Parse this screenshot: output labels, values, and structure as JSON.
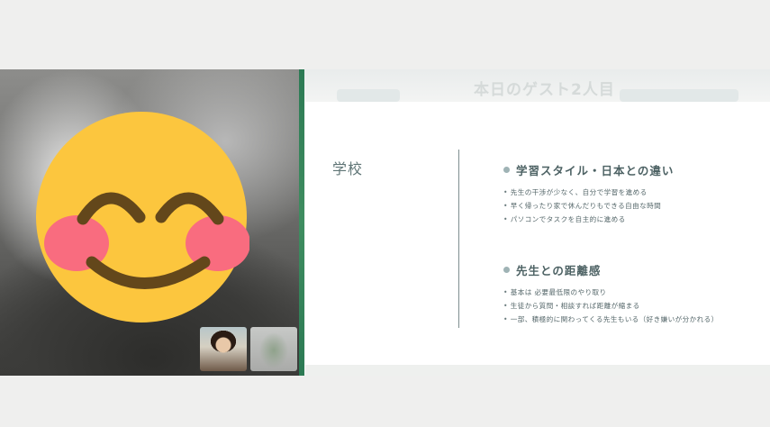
{
  "slide": {
    "ghost_title": "本日のゲスト2人目",
    "title": "学校",
    "sections": [
      {
        "heading": "学習スタイル・日本との違い",
        "items": [
          "先生の干渉が少なく、自分で学習を進める",
          "早く帰ったり家で休んだりもできる自由な時間",
          "パソコンでタスクを自主的に進める"
        ]
      },
      {
        "heading": "先生との距離感",
        "items": [
          "基本は 必要最低限のやり取り",
          "生徒から質問・相談すれば距離が縮まる",
          "一部、積極的に関わってくる先生もいる（好き嫌いが分かれる）"
        ]
      }
    ]
  },
  "video": {
    "main_participant": "participant-main",
    "thumbnails": [
      "participant-1",
      "participant-2"
    ]
  },
  "colors": {
    "accent_border": "#3f8d60",
    "slide_text": "#4d6264",
    "emoji_face": "#fcc63e",
    "emoji_cheek": "#f96c7f"
  }
}
